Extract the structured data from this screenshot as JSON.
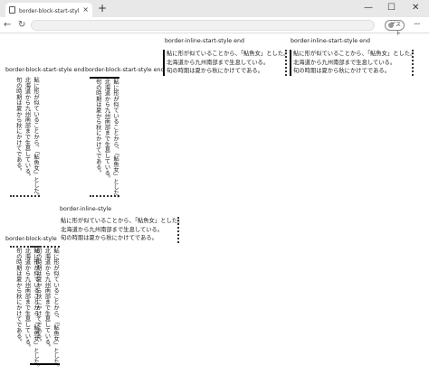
{
  "browser": {
    "tab_title": "border-block-start-styleプロパテ",
    "tab_close": "×",
    "new_tab": "+",
    "win_min": "—",
    "win_max": "☐",
    "win_close": "✕",
    "nav_back": "←",
    "nav_forward": "→",
    "nav_reload": "↻",
    "profile_label": "ゲスト",
    "menu": "···"
  },
  "examples": [
    {
      "label": "border-block-start-style end",
      "lines": [
        "鮎に形が似ていることから、「鮎魚女」とした。",
        "北海道から九州南部まで生息している。",
        "旬の時期は夏から秋にかけてである。"
      ]
    },
    {
      "label": "border-block-start-style end",
      "lines": [
        "鮎に形が似ていることから、「鮎魚女」とした。",
        "北海道から九州南部まで生息している。",
        "旬の時期は夏から秋にかけてである。"
      ]
    },
    {
      "label": "border-inline-start-style end",
      "lines": [
        "鮎に形が似ていることから、「鮎魚女」とした。",
        "北海道から九州南部まで生息している。",
        "旬の時期は夏から秋にかけてである。"
      ]
    },
    {
      "label": "border-inline-start-style end",
      "lines": [
        "鮎に形が似ていることから、「鮎魚女」とした。",
        "北海道から九州南部まで生息している。",
        "旬の時期は夏から秋にかけてである。"
      ]
    },
    {
      "label": "border-inline-style",
      "lines": [
        "鮎に形が似ていることから、「鮎魚女」とした。",
        "北海道から九州南部まで生息している。",
        "旬の時期は夏から秋にかけてである。"
      ]
    },
    {
      "label": "border-block-style",
      "lines": [
        "鮎に形が似ていることから、「鮎魚女」とした。",
        "北海道から九州南部まで生息している。",
        "旬の時期は夏から秋にかけてである。"
      ]
    },
    {
      "label": "",
      "lines": [
        "鮎に形が似ていることから、「鮎魚女」とした。",
        "北海道から九州南部まで生息している。",
        "旬の時期は夏から秋にかけてである。"
      ]
    }
  ]
}
